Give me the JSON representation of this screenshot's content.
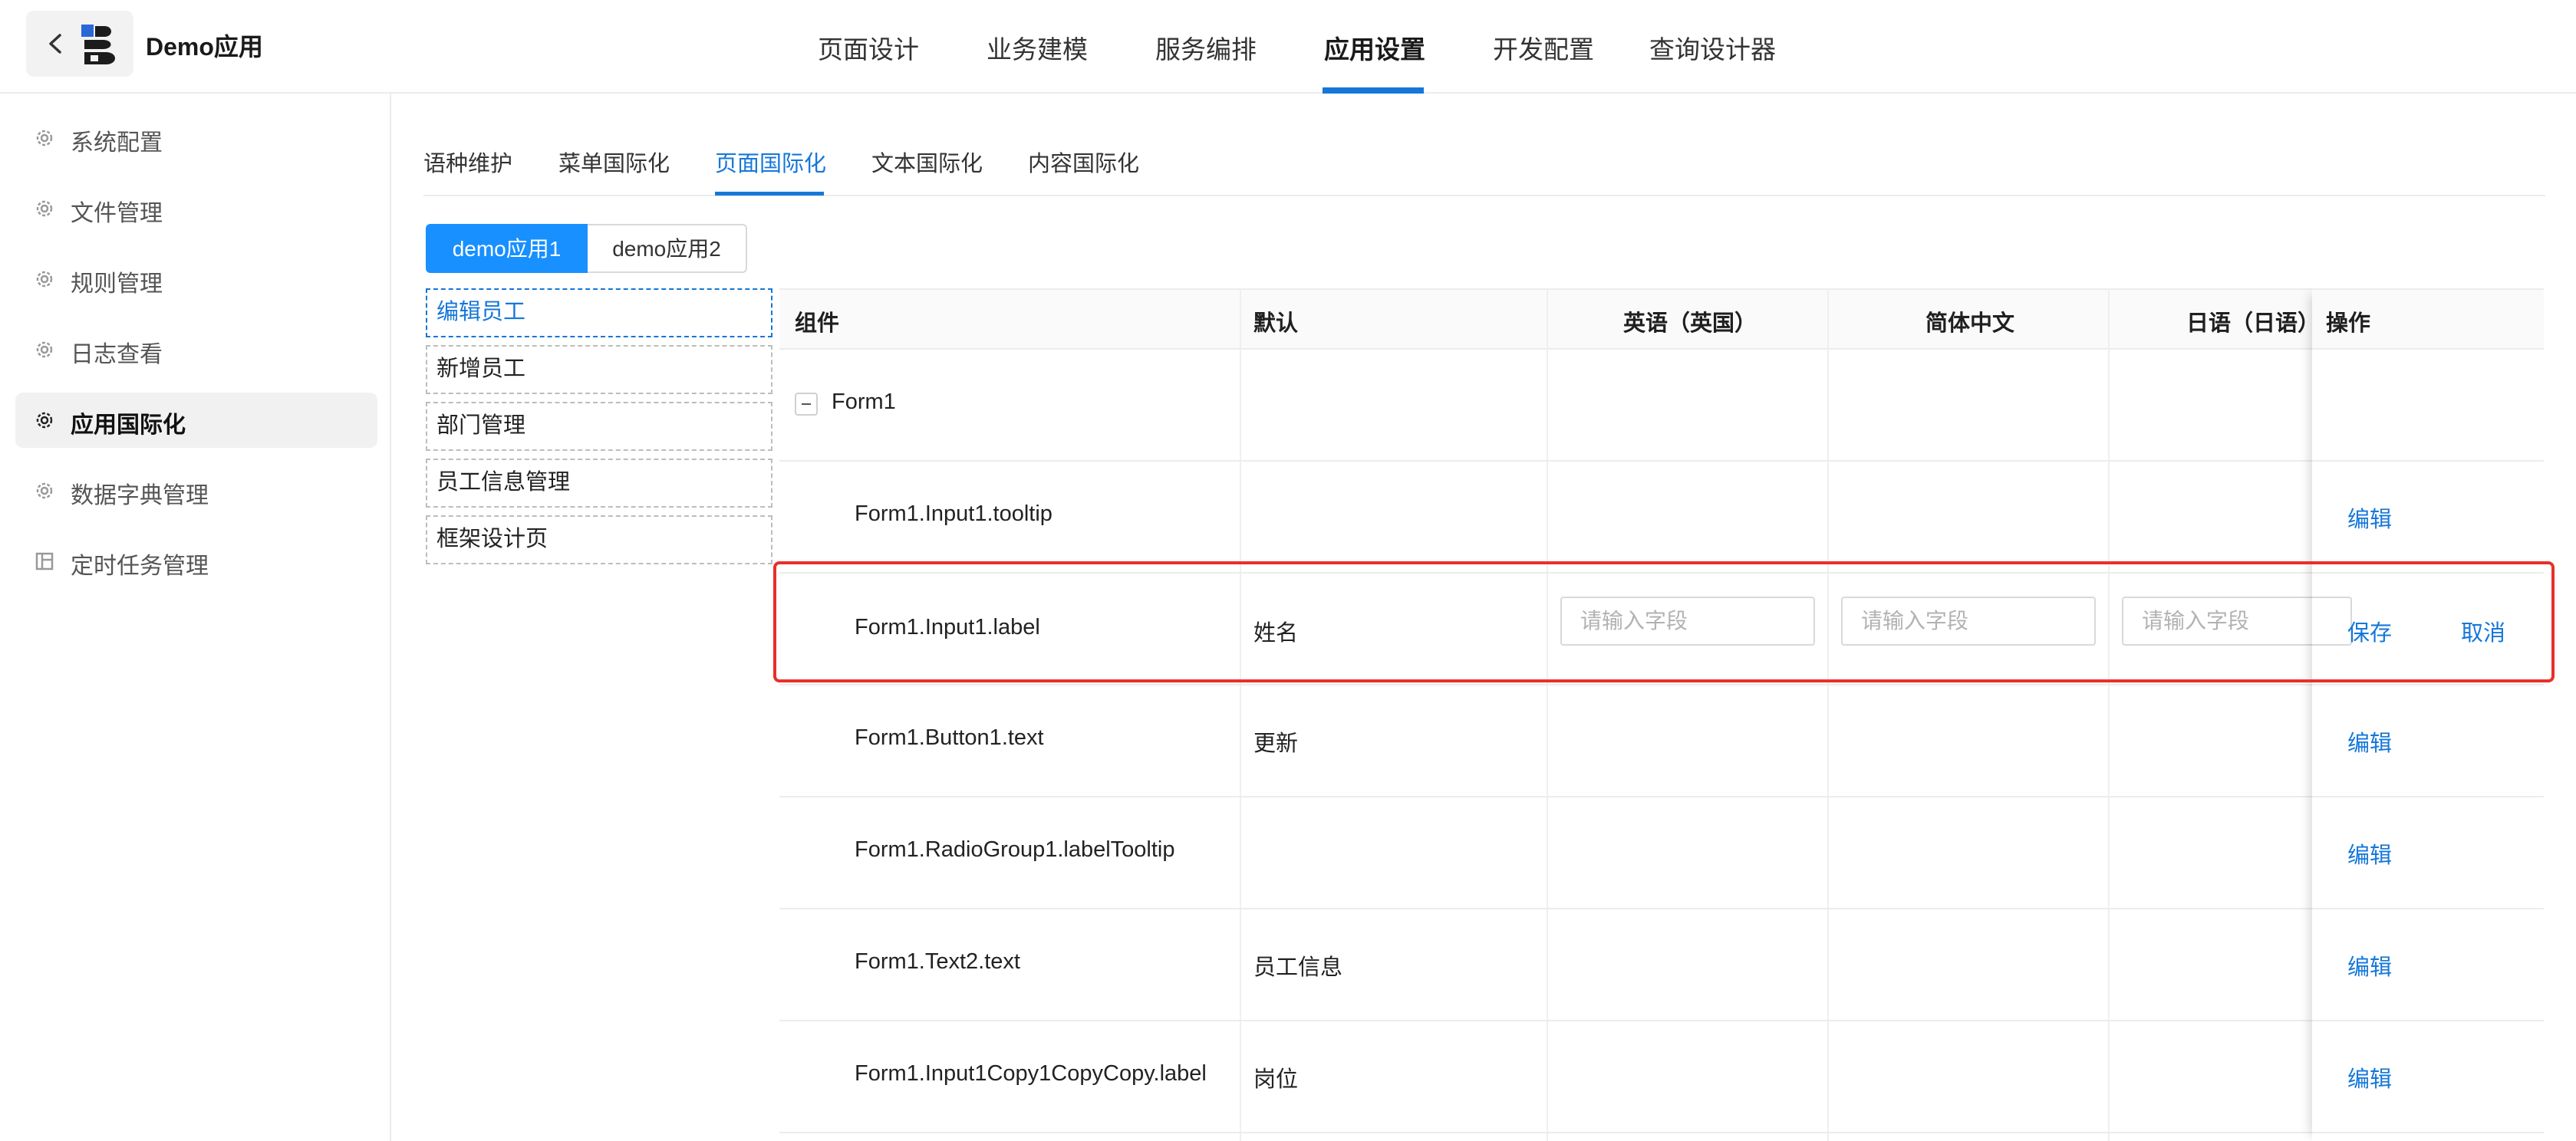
{
  "header": {
    "app_name": "Demo应用",
    "nav": [
      "页面设计",
      "业务建模",
      "服务编排",
      "应用设置",
      "开发配置",
      "查询设计器"
    ],
    "active_nav": "应用设置"
  },
  "sidebar": {
    "items": [
      {
        "label": "系统配置",
        "icon": "gear-icon"
      },
      {
        "label": "文件管理",
        "icon": "gear-icon"
      },
      {
        "label": "规则管理",
        "icon": "gear-icon"
      },
      {
        "label": "日志查看",
        "icon": "gear-icon"
      },
      {
        "label": "应用国际化",
        "icon": "gear-icon"
      },
      {
        "label": "数据字典管理",
        "icon": "gear-icon"
      },
      {
        "label": "定时任务管理",
        "icon": "layout-icon"
      }
    ],
    "active": "应用国际化"
  },
  "subtabs": {
    "items": [
      "语种维护",
      "菜单国际化",
      "页面国际化",
      "文本国际化",
      "内容国际化"
    ],
    "active": "页面国际化"
  },
  "apps": {
    "items": [
      "demo应用1",
      "demo应用2"
    ],
    "active": "demo应用1"
  },
  "pages": {
    "items": [
      "编辑员工",
      "新增员工",
      "部门管理",
      "员工信息管理",
      "框架设计页"
    ],
    "active": "编辑员工"
  },
  "table": {
    "columns": [
      "组件",
      "默认",
      "英语（英国）",
      "简体中文",
      "日语（日语）",
      "操作"
    ],
    "group": "Form1",
    "rows": [
      {
        "component": "Form1.Input1.tooltip",
        "default": "",
        "action": "编辑"
      },
      {
        "component": "Form1.Input1.label",
        "default": "姓名",
        "editing": true,
        "save": "保存",
        "cancel": "取消",
        "placeholder": "请输入字段"
      },
      {
        "component": "Form1.Button1.text",
        "default": "更新",
        "action": "编辑"
      },
      {
        "component": "Form1.RadioGroup1.labelTooltip",
        "default": "",
        "action": "编辑"
      },
      {
        "component": "Form1.Text2.text",
        "default": "员工信息",
        "action": "编辑"
      },
      {
        "component": "Form1.Input1Copy1CopyCopy.label",
        "default": "岗位",
        "action": "编辑"
      }
    ]
  },
  "colors": {
    "accent": "#1677d8",
    "highlight": "#e8302a"
  }
}
